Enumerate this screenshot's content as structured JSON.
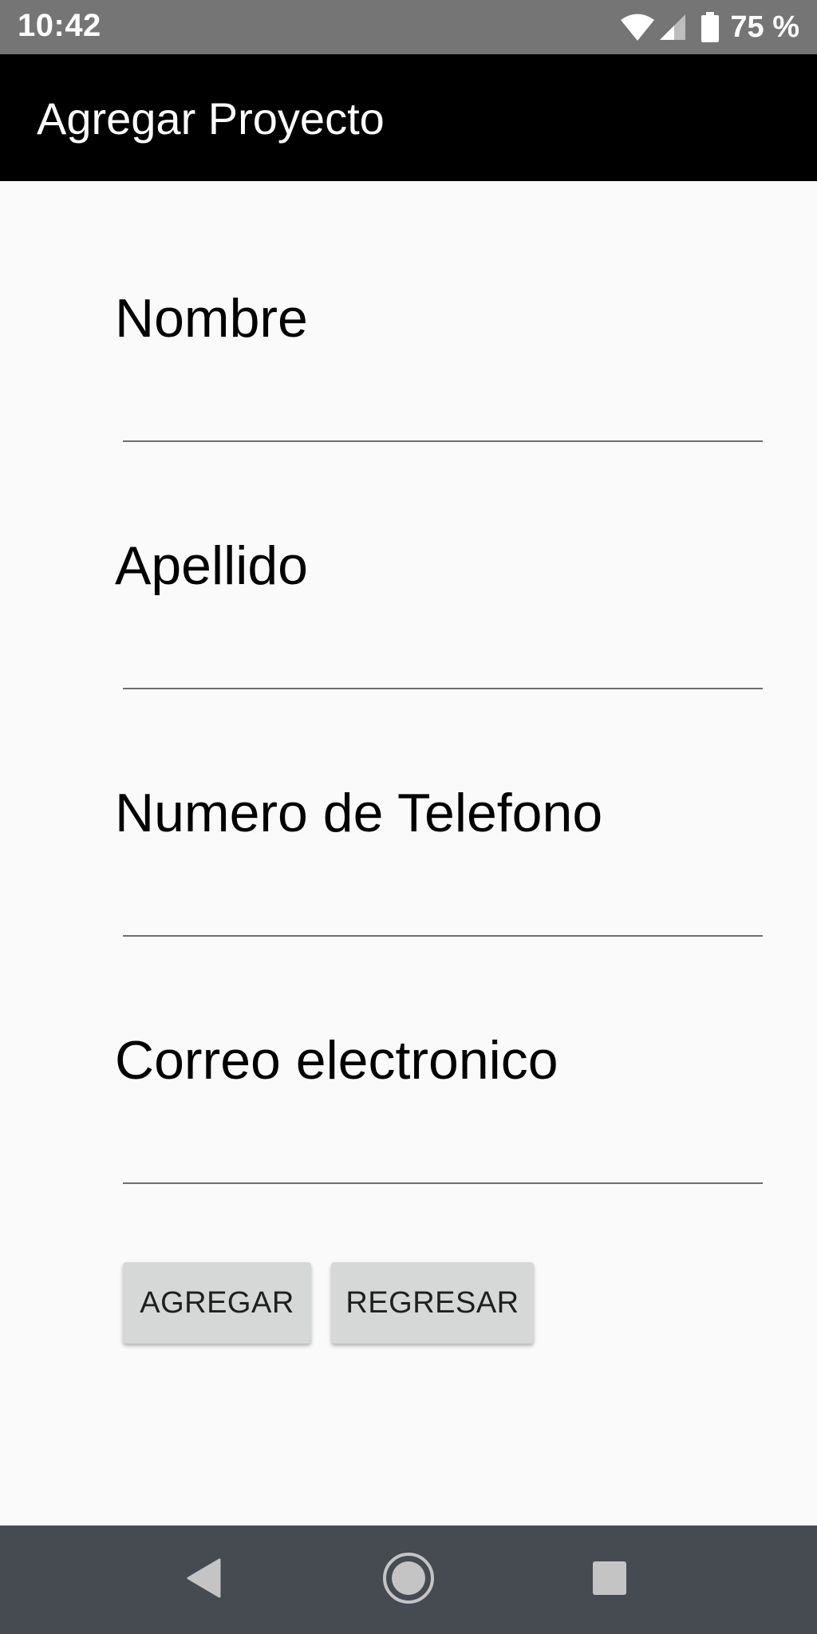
{
  "status_bar": {
    "time": "10:42",
    "battery": "75 %",
    "icons": [
      "wifi-icon",
      "signal-icon",
      "battery-icon"
    ]
  },
  "app_bar": {
    "title": "Agregar Proyecto"
  },
  "form": {
    "fields": [
      {
        "label": "Nombre",
        "value": ""
      },
      {
        "label": "Apellido",
        "value": ""
      },
      {
        "label": "Numero de Telefono",
        "value": ""
      },
      {
        "label": "Correo electronico",
        "value": ""
      }
    ],
    "buttons": {
      "add_label": "AGREGAR",
      "back_label": "REGRESAR"
    }
  },
  "nav_bar": {
    "icons": [
      "back-icon",
      "home-icon",
      "recents-icon"
    ]
  },
  "colors": {
    "status_bar": "#757575",
    "app_bar": "#000000",
    "background": "#fafafa",
    "button": "#d6d7d7",
    "nav_bar": "#454b50"
  }
}
